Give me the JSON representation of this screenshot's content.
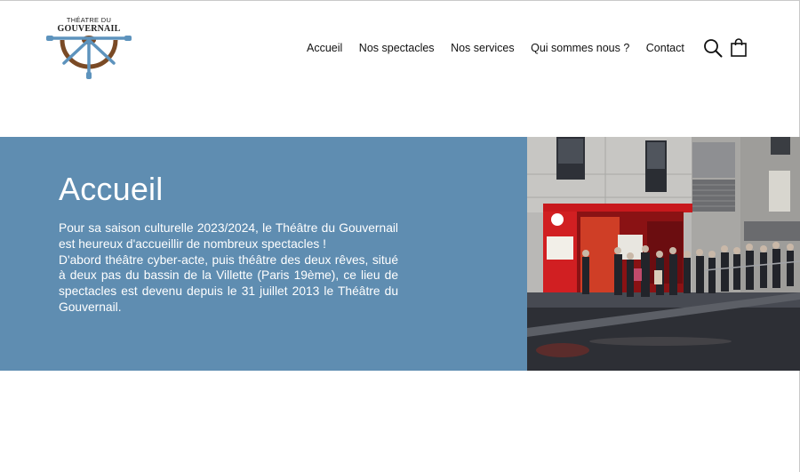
{
  "logo": {
    "line1": "THÉATRE DU",
    "line2": "GOUVERNAIL",
    "icon": "ship-wheel-icon"
  },
  "nav": {
    "items": [
      {
        "label": "Accueil"
      },
      {
        "label": "Nos spectacles"
      },
      {
        "label": "Nos services"
      },
      {
        "label": "Qui sommes nous ?"
      },
      {
        "label": "Contact"
      }
    ],
    "search_icon": "search-icon",
    "cart_icon": "shopping-bag-icon"
  },
  "hero": {
    "title": "Accueil",
    "paragraph1": "Pour sa saison culturelle 2023/2024, le Théâtre du Gouvernail est heureux d'accueillir de nombreux spectacles !",
    "paragraph2": "D'abord théâtre cyber-acte, puis théâtre des deux rêves, situé à deux pas du bassin de la Villette (Paris 19ème), ce lieu de spectacles est devenu depuis le 31 juillet 2013 le Théâtre du Gouvernail.",
    "background_color": "#5f8db1"
  }
}
